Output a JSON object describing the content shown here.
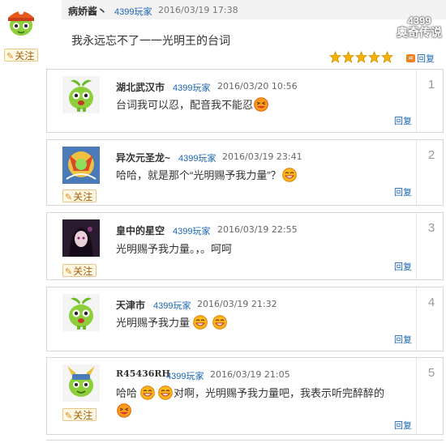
{
  "original_post": {
    "username": "病娇酱丶",
    "tag": "4399玩家",
    "time": "2016/03/19 17:38",
    "text": "我永远忘不了一一光明王的台词",
    "follow_label": "关注",
    "reply_label": "回复",
    "rating_stars": 5
  },
  "watermark": {
    "line1": "4399",
    "line2": "奥奇传说"
  },
  "replies": [
    {
      "floor": "1",
      "username": "湖北武汉市",
      "tag": "4399玩家",
      "time": "2016/03/20 10:56",
      "text": "台词我可以忍，配音我不能忍",
      "text2": "",
      "reply_label": "回复",
      "follow_label": ""
    },
    {
      "floor": "2",
      "username": "异次元圣龙~",
      "tag": "4399玩家",
      "time": "2016/03/19 23:41",
      "text": "哈哈，就是那个“光明赐予我力量”？",
      "text2": "",
      "reply_label": "回复",
      "follow_label": "关注"
    },
    {
      "floor": "3",
      "username": "皇中的星空",
      "tag": "4399玩家",
      "time": "2016/03/19 22:55",
      "text": "光明赐予我力量。，。呵呵",
      "text2": "",
      "reply_label": "回复",
      "follow_label": "关注"
    },
    {
      "floor": "4",
      "username": "天津市",
      "tag": "4399玩家",
      "time": "2016/03/19 21:32",
      "text": "光明赐予我力量",
      "text2": "",
      "reply_label": "回复",
      "follow_label": ""
    },
    {
      "floor": "5",
      "username": "R45436RH",
      "tag": "4399玩家",
      "time": "2016/03/19 21:05",
      "text": "哈哈",
      "text2": "对啊，光明赐予我力量吧，我表示听完醉醉的",
      "reply_label": "回复",
      "follow_label": "关注"
    }
  ],
  "icons": {
    "original_avatar": "orange-cap-mascot-avatar",
    "green_mascot": "green-bean-sprout-avatar",
    "emoji_grin": "grinning-emoji-icon",
    "emoji_laugh": "laughing-emoji-icon",
    "star": "rating-star-icon",
    "pen": "pen-icon"
  },
  "colors": {
    "link": "#1a64b4",
    "accent": "#f08020",
    "border": "#d6d6d6",
    "follow_bg": "#fff7e2"
  }
}
